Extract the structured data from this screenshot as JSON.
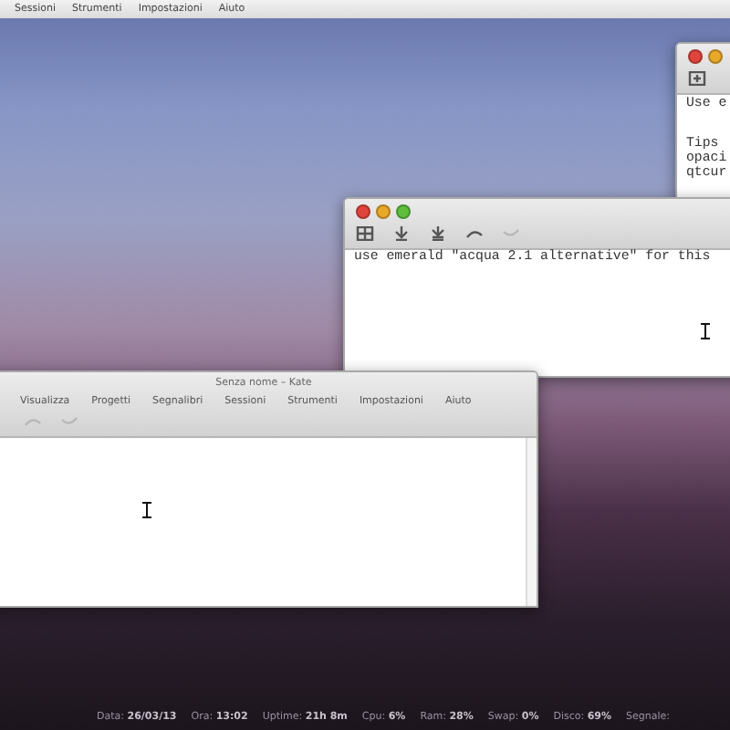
{
  "top_menu": [
    "Sessioni",
    "Strumenti",
    "Impostazioni",
    "Aiuto"
  ],
  "back_window": {
    "first_line": "Use e",
    "tips_lines": [
      "Tips",
      "opaci",
      "qtcur"
    ]
  },
  "middle_window": {
    "line": "use emerald \"acqua 2.1 alternative\" for this"
  },
  "kate_window": {
    "title": "Senza nome – Kate",
    "menu": [
      "Visualizza",
      "Progetti",
      "Segnalibri",
      "Sessioni",
      "Strumenti",
      "Impostazioni",
      "Aiuto"
    ]
  },
  "status_bar": [
    {
      "label": "Data:",
      "value": "26/03/13"
    },
    {
      "label": "Ora:",
      "value": "13:02"
    },
    {
      "label": "Uptime:",
      "value": "21h 8m"
    },
    {
      "label": "Cpu:",
      "value": "6%"
    },
    {
      "label": "Ram:",
      "value": "28%"
    },
    {
      "label": "Swap:",
      "value": "0%"
    },
    {
      "label": "Disco:",
      "value": "69%"
    },
    {
      "label": "Segnale:"
    }
  ]
}
